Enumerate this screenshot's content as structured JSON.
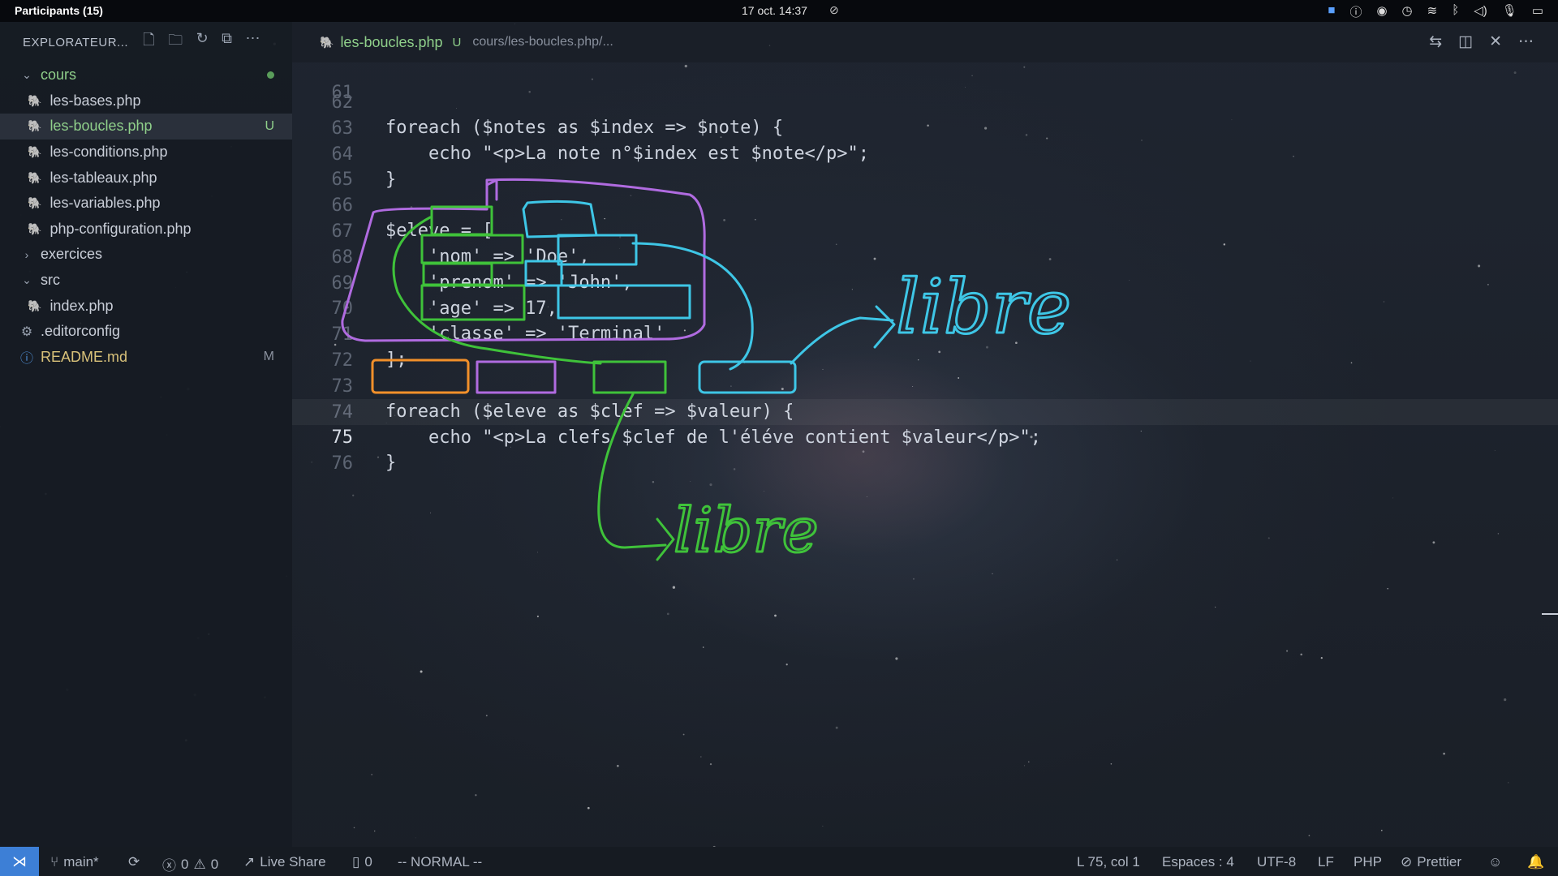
{
  "topbar": {
    "left_text": "Participants (15)",
    "center_text": "17 oct.  14:37"
  },
  "explorer": {
    "title": "EXPLORATEUR...",
    "tree": [
      {
        "label": "cours",
        "kind": "folder-open",
        "badge": ""
      },
      {
        "label": "les-bases.php",
        "kind": "php",
        "badge": ""
      },
      {
        "label": "les-boucles.php",
        "kind": "php",
        "badge": "U",
        "active": true
      },
      {
        "label": "les-conditions.php",
        "kind": "php",
        "badge": ""
      },
      {
        "label": "les-tableaux.php",
        "kind": "php",
        "badge": ""
      },
      {
        "label": "les-variables.php",
        "kind": "php",
        "badge": ""
      },
      {
        "label": "php-configuration.php",
        "kind": "php",
        "badge": ""
      },
      {
        "label": "exercices",
        "kind": "folder-closed",
        "badge": ""
      },
      {
        "label": "src",
        "kind": "folder-open",
        "badge": ""
      },
      {
        "label": "index.php",
        "kind": "php",
        "badge": ""
      },
      {
        "label": ".editorconfig",
        "kind": "gear",
        "badge": ""
      },
      {
        "label": "README.md",
        "kind": "info",
        "badge": "M"
      }
    ]
  },
  "tab": {
    "name": "les-boucles.php",
    "status": "U",
    "path": "cours/les-boucles.php/..."
  },
  "editor": {
    "lines": [
      {
        "n": "61",
        "text": ""
      },
      {
        "n": "62",
        "text": "foreach ($notes as $index => $note) {"
      },
      {
        "n": "63",
        "text": "    echo \"<p>La note n°$index est $note</p>\";"
      },
      {
        "n": "64",
        "text": "}"
      },
      {
        "n": "65",
        "text": ""
      },
      {
        "n": "66",
        "text": "$eleve = ["
      },
      {
        "n": "67",
        "text": "    'nom' => 'Doe',"
      },
      {
        "n": "68",
        "text": "    'prenom' => 'John',"
      },
      {
        "n": "69",
        "text": "    'age' => 17,"
      },
      {
        "n": "70",
        "text": "    'classe' => 'Terminal'"
      },
      {
        "n": "71",
        "text": "];"
      },
      {
        "n": "72",
        "text": ""
      },
      {
        "n": "73",
        "text": "foreach ($eleve as $clef => $valeur) {"
      },
      {
        "n": "74",
        "text": "    echo \"<p>La clefs $clef de l'éléve contient $valeur</p>\";"
      },
      {
        "n": "75",
        "text": "}"
      },
      {
        "n": "76",
        "text": ""
      }
    ],
    "current_line": "75",
    "annotation_blue": "libre",
    "annotation_green": "libre"
  },
  "statusbar": {
    "branch": "main*",
    "errors": "0",
    "warnings": "0",
    "live_share": "Live Share",
    "ports": "0",
    "mode": "-- NORMAL --",
    "position": "L 75, col 1",
    "spaces": "Espaces : 4",
    "encoding": "UTF-8",
    "eol": "LF",
    "language": "PHP",
    "formatter": "Prettier"
  },
  "colors": {
    "keyword": "#e46a6a",
    "string": "#d9c27a",
    "ink_purple": "#b06be0",
    "ink_green": "#3fc23a",
    "ink_blue": "#3ec6e6",
    "ink_orange": "#f2902a",
    "accent": "#3d7fd6"
  }
}
